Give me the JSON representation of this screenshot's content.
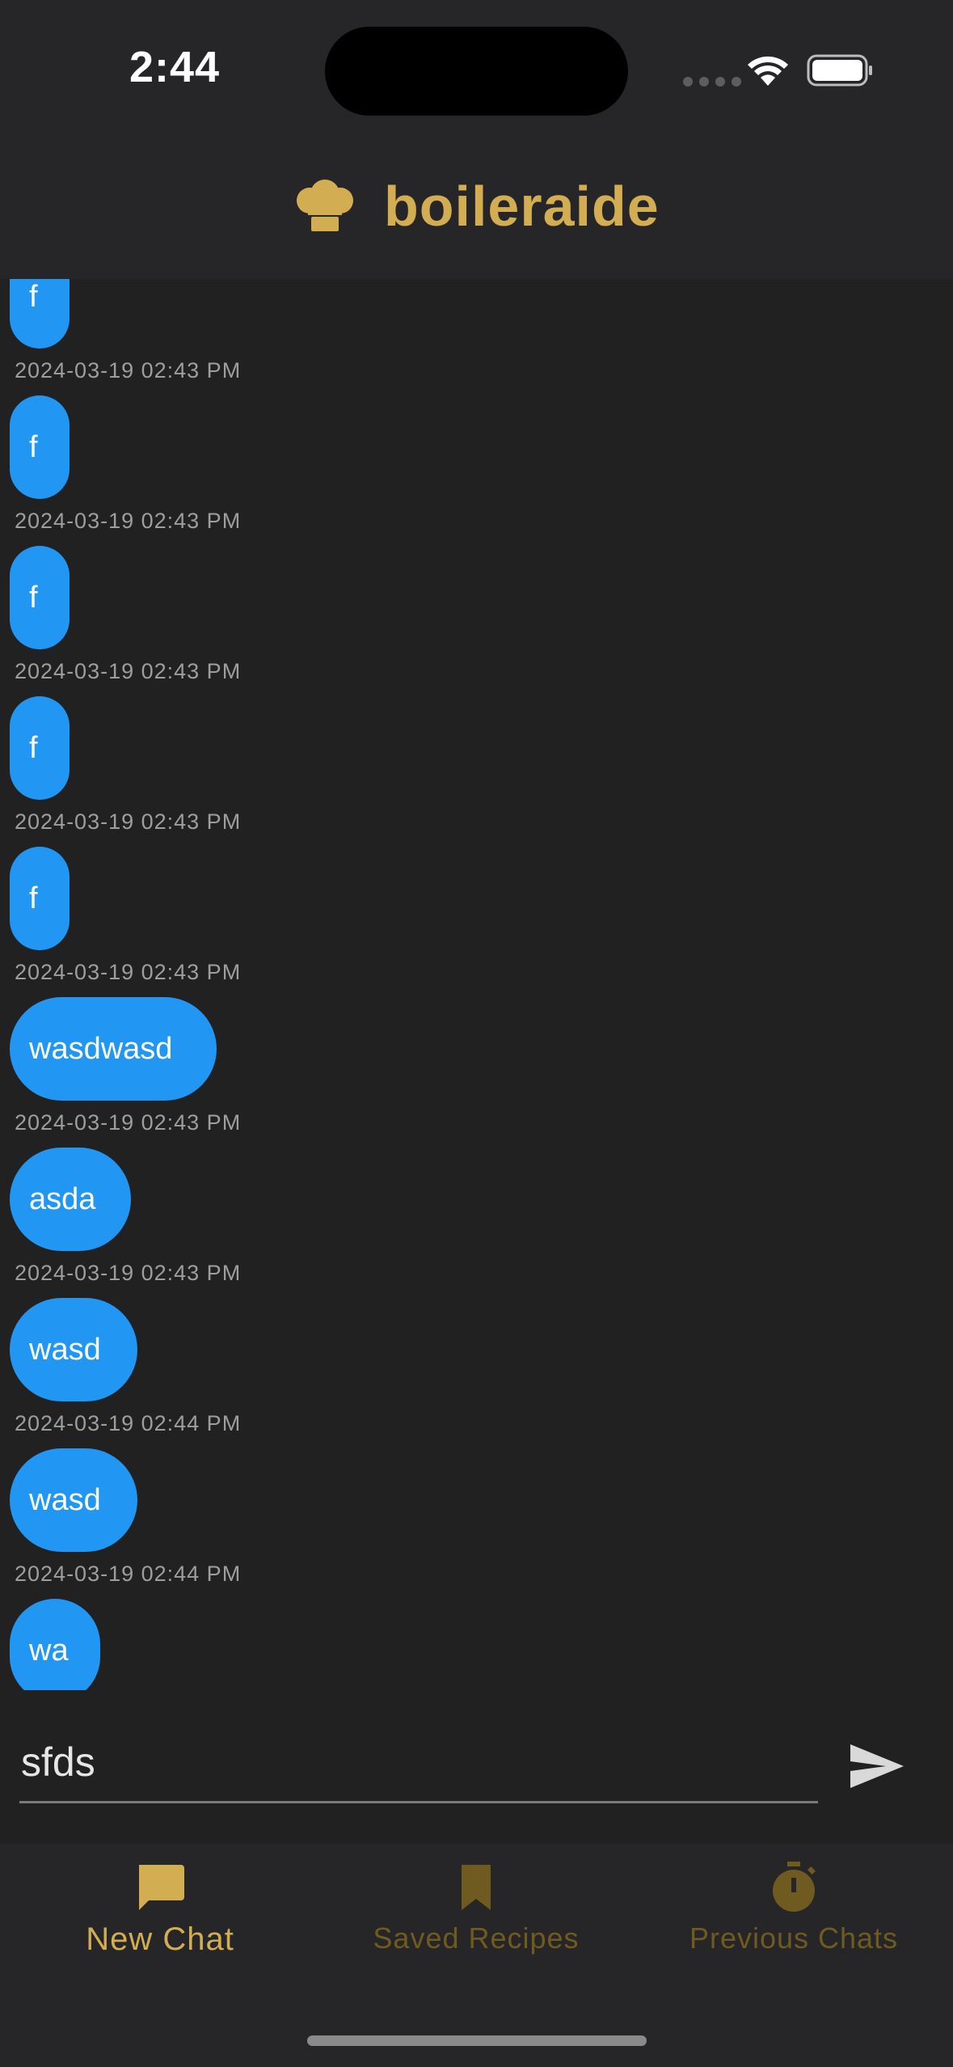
{
  "status_bar": {
    "time": "2:44"
  },
  "header": {
    "title": "boileraide",
    "icon": "chef-hat-icon",
    "brand_color": "#d3ad52"
  },
  "messages": [
    {
      "text": "f",
      "timestamp": "2024-03-19 02:43 PM"
    },
    {
      "text": "f",
      "timestamp": "2024-03-19 02:43 PM"
    },
    {
      "text": "f",
      "timestamp": "2024-03-19 02:43 PM"
    },
    {
      "text": "f",
      "timestamp": "2024-03-19 02:43 PM"
    },
    {
      "text": "f",
      "timestamp": "2024-03-19 02:43 PM"
    },
    {
      "text": "wasdwasd",
      "timestamp": "2024-03-19 02:43 PM"
    },
    {
      "text": "asda",
      "timestamp": "2024-03-19 02:43 PM"
    },
    {
      "text": "wasd",
      "timestamp": "2024-03-19 02:44 PM"
    },
    {
      "text": "wasd",
      "timestamp": "2024-03-19 02:44 PM"
    },
    {
      "text": "wa",
      "timestamp": ""
    }
  ],
  "input": {
    "value": "sfds",
    "send_icon": "send-icon"
  },
  "nav": {
    "items": [
      {
        "label": "New Chat",
        "icon": "chat-bubble-icon",
        "active": true
      },
      {
        "label": "Saved Recipes",
        "icon": "bookmark-icon",
        "active": false
      },
      {
        "label": "Previous Chats",
        "icon": "stopwatch-icon",
        "active": false
      }
    ]
  },
  "colors": {
    "bubble": "#2196f3",
    "background": "#212121",
    "nav_active": "#d3ad52",
    "nav_inactive": "#6f5a1f"
  }
}
